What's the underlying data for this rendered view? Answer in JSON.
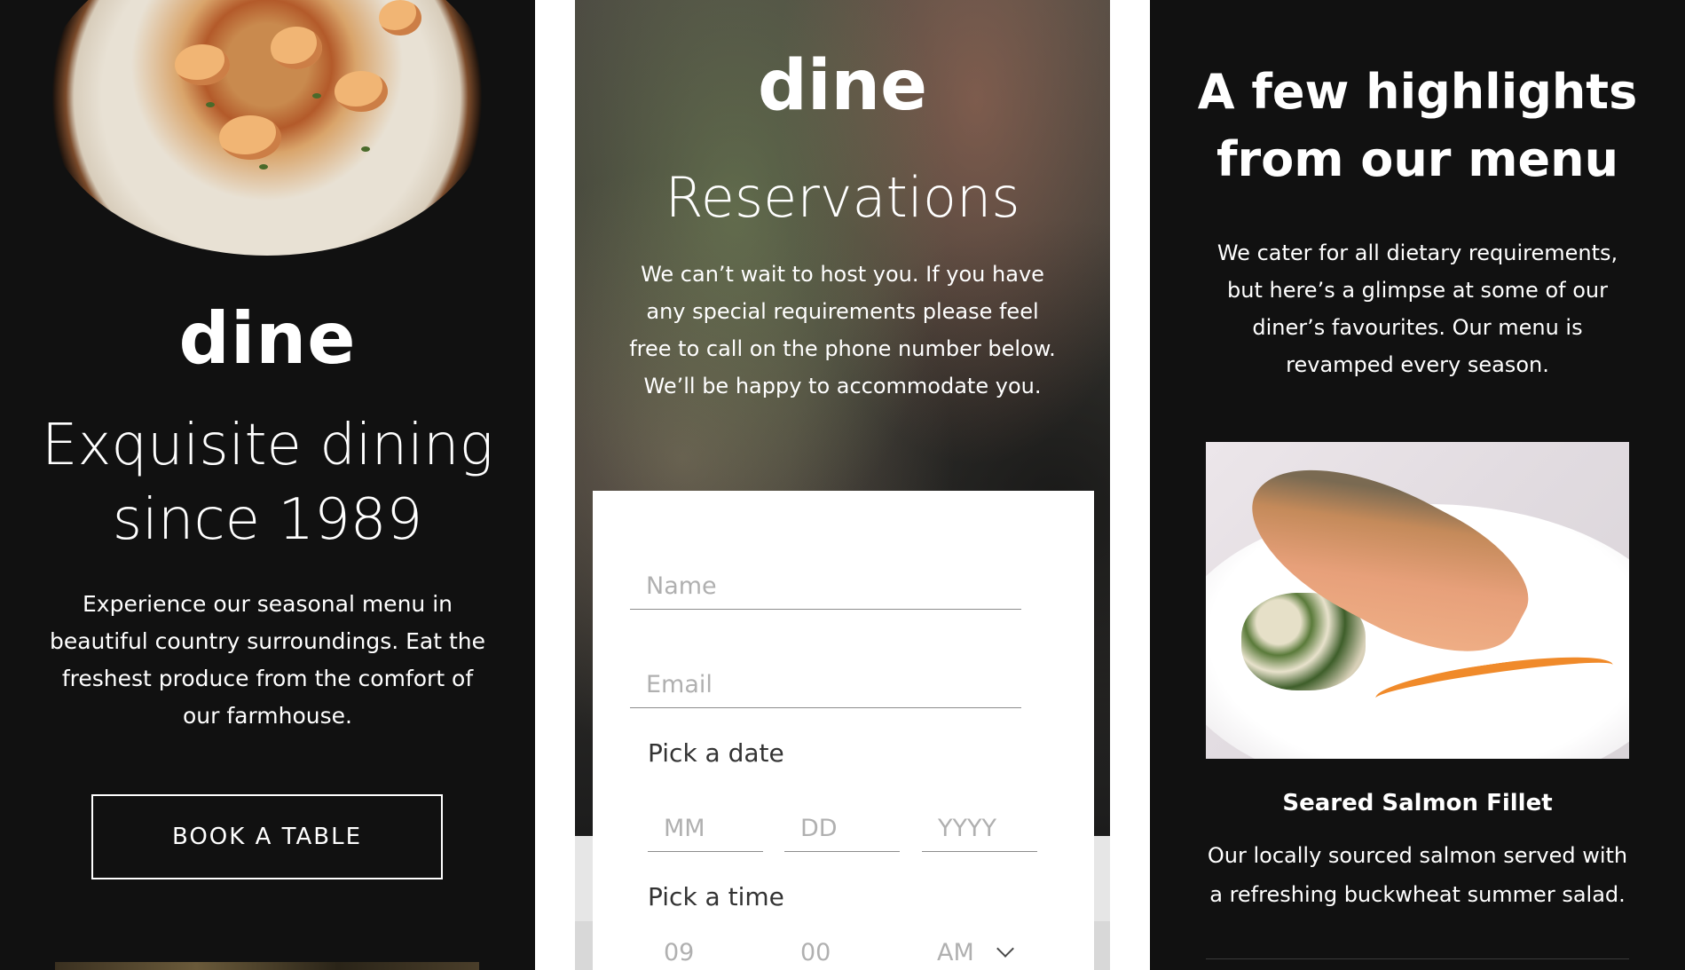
{
  "hero": {
    "brand": "dine",
    "title": "Exquisite dining since 1989",
    "text": "Experience our seasonal menu in beautiful country surroundings. Eat the freshest produce from the comfort of our farmhouse.",
    "button_label": "BOOK A TABLE"
  },
  "reservations": {
    "brand": "dine",
    "title": "Reservations",
    "text": "We can’t wait to host you. If you have any special requirements please feel free to call on the phone number below. We’ll be happy to accommodate you.",
    "form": {
      "name_placeholder": "Name",
      "email_placeholder": "Email",
      "date_label": "Pick a date",
      "month_placeholder": "MM",
      "day_placeholder": "DD",
      "year_placeholder": "YYYY",
      "time_label": "Pick a time",
      "hour_value": "09",
      "minute_value": "00",
      "ampm_value": "AM"
    }
  },
  "highlights": {
    "title": "A few highlights from our menu",
    "text": "We cater for all dietary requirements, but here’s a glimpse at some of our diner’s favourites. Our menu is revamped every season.",
    "dish": {
      "name": "Seared Salmon Fillet",
      "description": "Our locally sourced salmon served with a refreshing buckwheat summer salad."
    }
  },
  "colors": {
    "dark_bg": "#111111",
    "text_light": "#ffffff",
    "form_bg": "#ffffff",
    "placeholder": "#b0b0b0"
  }
}
